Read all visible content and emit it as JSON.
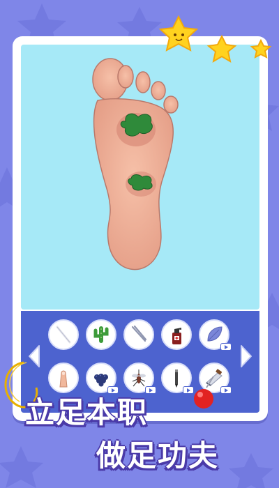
{
  "game": {
    "slogan_line1": "立足本职",
    "slogan_line2": "做足功夫"
  },
  "stars_earned": 3,
  "foot": {
    "infections": [
      {
        "name": "upper-infection",
        "color": "#2f8a3a"
      },
      {
        "name": "lower-infection",
        "color": "#2f8a3a"
      }
    ]
  },
  "toolbar": {
    "row1": [
      {
        "name": "cotton-swab-tool-button",
        "icon": "cotton-swab-icon",
        "locked_ad": false
      },
      {
        "name": "cactus-tool-button",
        "icon": "cactus-icon",
        "locked_ad": false
      },
      {
        "name": "tweezers-tool-button",
        "icon": "tweezers-icon",
        "locked_ad": false
      },
      {
        "name": "spray-bottle-tool-button",
        "icon": "spray-bottle-icon",
        "locked_ad": false
      },
      {
        "name": "leaf-tool-button",
        "icon": "leaf-icon",
        "locked_ad": true
      }
    ],
    "row2": [
      {
        "name": "finger-tool-button",
        "icon": "finger-icon",
        "locked_ad": false
      },
      {
        "name": "grapes-tool-button",
        "icon": "grapes-icon",
        "locked_ad": true
      },
      {
        "name": "mosquito-tool-button",
        "icon": "mosquito-icon",
        "locked_ad": true
      },
      {
        "name": "pen-tool-button",
        "icon": "pen-icon",
        "locked_ad": true
      },
      {
        "name": "razor-tool-button",
        "icon": "razor-icon",
        "locked_ad": true
      }
    ]
  },
  "colors": {
    "background": "#7f86e8",
    "stage": "#a6e9f7",
    "tray": "#4d63cf",
    "star": "#ffd21f"
  }
}
